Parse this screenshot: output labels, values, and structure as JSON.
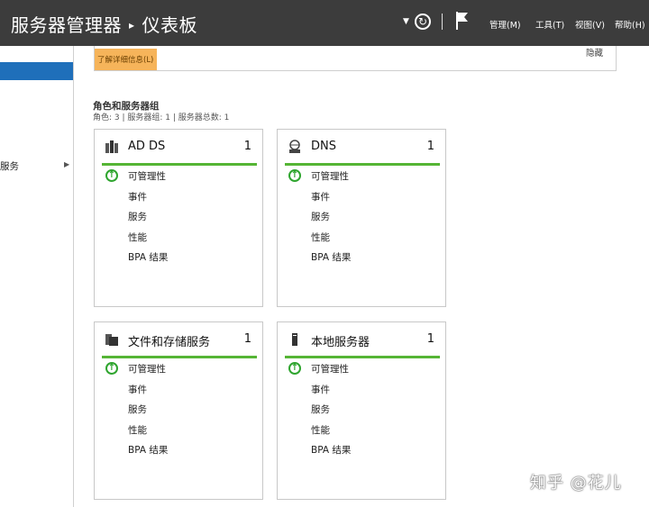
{
  "titlebar": {
    "app": "服务器管理器",
    "separator": "▸",
    "page": "仪表板",
    "menu": [
      "管理(M)",
      "工具(T)",
      "视图(V)",
      "帮助(H)"
    ]
  },
  "sidebar": {
    "items": [
      {
        "label": "",
        "selected": true
      },
      {
        "label": "服务"
      }
    ]
  },
  "banner": {
    "learn_more": "了解详细信息(L)",
    "hide": "隐藏"
  },
  "section": {
    "title": "角色和服务器组",
    "subtitle": "角色: 3 | 服务器组: 1 | 服务器总数: 1"
  },
  "tiles": [
    {
      "name": "AD DS",
      "count": "1",
      "icon": "ad-ds-icon",
      "rows": [
        "可管理性",
        "事件",
        "服务",
        "性能",
        "BPA 结果"
      ]
    },
    {
      "name": "DNS",
      "count": "1",
      "icon": "dns-icon",
      "rows": [
        "可管理性",
        "事件",
        "服务",
        "性能",
        "BPA 结果"
      ]
    },
    {
      "name": "文件和存储服务",
      "count": "1",
      "icon": "file-storage-icon",
      "rows": [
        "可管理性",
        "事件",
        "服务",
        "性能",
        "BPA 结果"
      ]
    },
    {
      "name": "本地服务器",
      "count": "1",
      "icon": "local-server-icon",
      "rows": [
        "可管理性",
        "事件",
        "服务",
        "性能",
        "BPA 结果"
      ]
    }
  ],
  "watermark": "知乎 @花儿",
  "colors": {
    "titlebar": "#3c3c3c",
    "status_ok": "#55b535",
    "accent": "#1f6fba",
    "banner": "#f6b45a"
  }
}
